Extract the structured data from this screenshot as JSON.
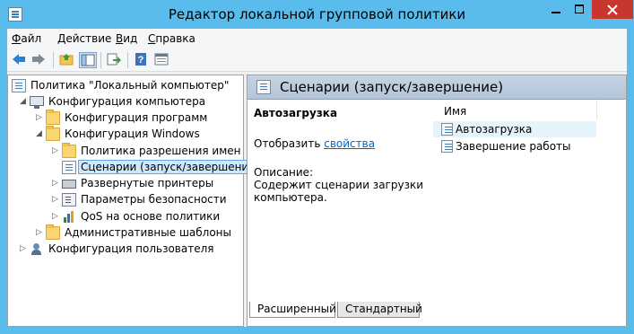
{
  "window": {
    "title": "Редактор локальной групповой политики"
  },
  "menu": [
    {
      "accel": "Ф",
      "rest": "айл"
    },
    {
      "accel": "Д",
      "rest": "ействие"
    },
    {
      "accel": "В",
      "rest": "ид"
    },
    {
      "accel": "С",
      "rest": "правка"
    }
  ],
  "toolbar": {
    "icons": [
      "back-icon",
      "forward-icon",
      "up-folder-icon",
      "show-hide-tree-icon",
      "export-list-icon",
      "help-icon",
      "properties-icon"
    ]
  },
  "tree": {
    "root": "Политика \"Локальный компьютер\"",
    "computer_config": "Конфигурация компьютера",
    "software_config": "Конфигурация программ",
    "windows_config": "Конфигурация Windows",
    "name_resolution_policy": "Политика разрешения имен",
    "scripts": "Сценарии (запуск/завершение)",
    "deployed_printers": "Развернутые принтеры",
    "security_settings": "Параметры безопасности",
    "qos": "QoS на основе политики",
    "admin_templates": "Административные шаблоны",
    "user_config": "Конфигурация пользователя"
  },
  "details": {
    "header_title": "Сценарии (запуск/завершение)",
    "selected_title": "Автозагрузка",
    "show_prefix": "Отобразить",
    "show_link": "свойства",
    "description_label": "Описание:",
    "description_text": "Содержит сценарии загрузки компьютера.",
    "column_name": "Имя",
    "items": [
      "Автозагрузка",
      "Завершение работы"
    ]
  },
  "tabs": {
    "extended": "Расширенный",
    "standard": "Стандартный"
  }
}
